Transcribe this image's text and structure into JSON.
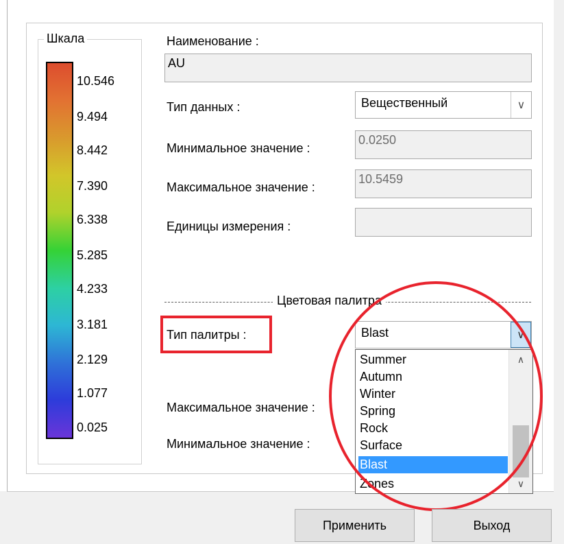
{
  "scale": {
    "title": "Шкала",
    "colors": [
      "#dd4d2e",
      "#e27232",
      "#d9992d",
      "#d2c62a",
      "#b0d22c",
      "#35d236",
      "#2dd0a3",
      "#2db7d4",
      "#2f72d8",
      "#2d3cda",
      "#6a35d9"
    ],
    "ticks": [
      "10.546",
      "9.494",
      "8.442",
      "7.390",
      "6.338",
      "5.285",
      "4.233",
      "3.181",
      "2.129",
      "1.077",
      "0.025"
    ]
  },
  "form": {
    "name_label": "Наименование :",
    "name_value": "AU",
    "data_type_label": "Тип данных :",
    "data_type_value": "Вещественный",
    "min_label": "Минимальное значение :",
    "min_value": "0.0250",
    "max_label": "Максимальное значение :",
    "max_value": "10.5459",
    "units_label": "Единицы измерения :",
    "units_value": ""
  },
  "palette": {
    "section_label": "Цветовая палитра",
    "type_label": "Тип палитры :",
    "type_value": "Blast",
    "max_label": "Максимальное значение :",
    "min_label": "Минимальное значение :",
    "options": [
      "Summer",
      "Autumn",
      "Winter",
      "Spring",
      "Rock",
      "Surface",
      "Blast",
      "Zones"
    ],
    "selected": "Blast"
  },
  "buttons": {
    "apply": "Применить",
    "exit": "Выход"
  },
  "annotation_color": "#e8232d",
  "icons": {
    "combo_arrow": "chevron-down-icon",
    "scroll_up": "chevron-up-icon",
    "scroll_down": "chevron-down-icon"
  }
}
